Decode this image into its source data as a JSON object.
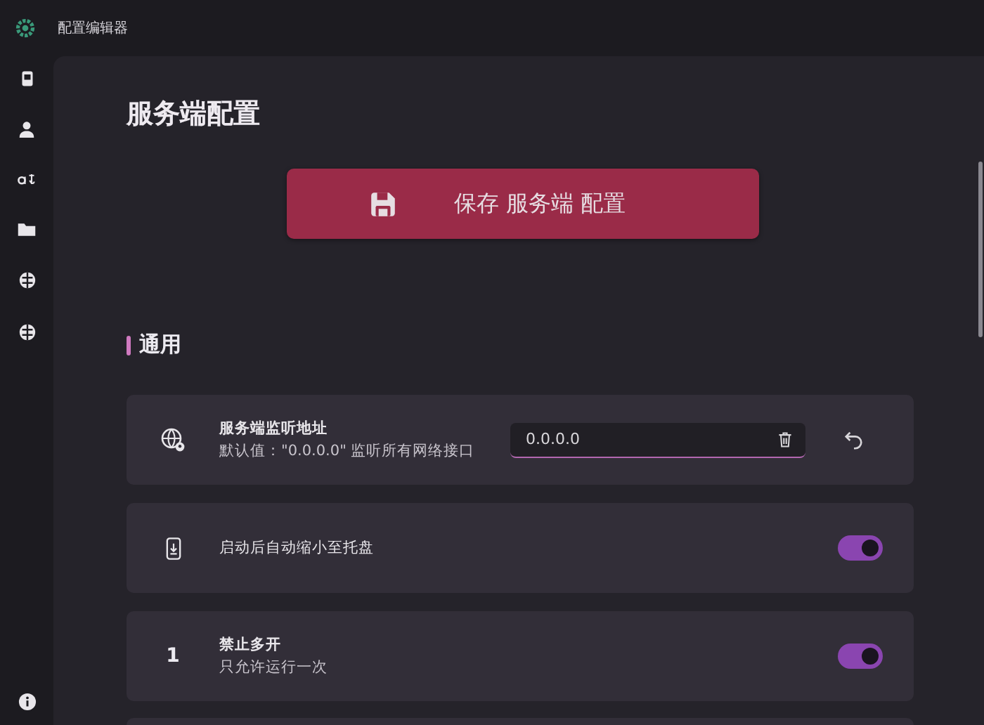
{
  "window": {
    "title": "配置编辑器"
  },
  "page": {
    "heading": "服务端配置",
    "save_button": "保存 服务端 配置"
  },
  "section": {
    "title": "通用"
  },
  "settings": [
    {
      "kind": "input",
      "title": "服务端监听地址",
      "description": "默认值：\"0.0.0.0\" 监听所有网络接口",
      "value": "0.0.0.0"
    },
    {
      "kind": "toggle",
      "title": "启动后自动缩小至托盘",
      "on": true
    },
    {
      "kind": "toggle",
      "icon_text": "1",
      "title": "禁止多开",
      "description": "只允许运行一次",
      "on": true
    }
  ]
}
